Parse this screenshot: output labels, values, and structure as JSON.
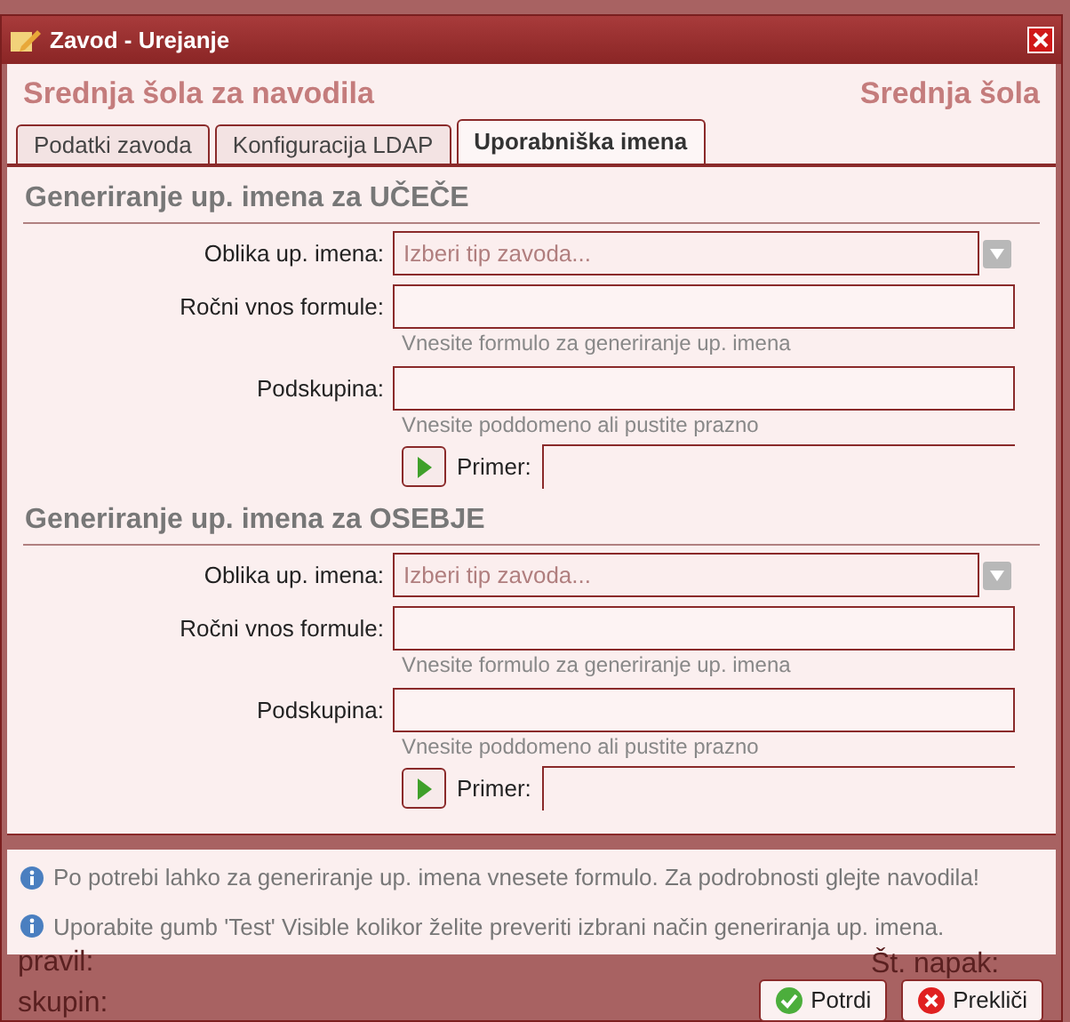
{
  "background_texts": [
    "pravil:",
    "skupin:",
    "Št. napak:"
  ],
  "window": {
    "title": "Zavod - Urejanje"
  },
  "header": {
    "name": "Srednja šola za navodila",
    "short_name": "Srednja šola"
  },
  "tabs": [
    {
      "label": "Podatki zavoda",
      "selected": false
    },
    {
      "label": "Konfiguracija LDAP",
      "selected": false
    },
    {
      "label": "Uporabniška imena",
      "selected": true
    }
  ],
  "sections": [
    {
      "title": "Generiranje up. imena za UČEČE",
      "fields": [
        {
          "kind": "select",
          "label": "Oblika up. imena:",
          "placeholder": "Izberi tip zavoda..."
        },
        {
          "kind": "text",
          "label": "Ročni vnos formule:",
          "hint": "Vnesite formulo za generiranje up. imena"
        },
        {
          "kind": "text",
          "label": "Podskupina:",
          "hint": "Vnesite poddomeno ali pustite prazno"
        },
        {
          "kind": "test",
          "label": "Primer:"
        }
      ]
    },
    {
      "title": "Generiranje up. imena za OSEBJE",
      "fields": [
        {
          "kind": "select",
          "label": "Oblika up. imena:",
          "placeholder": "Izberi tip zavoda..."
        },
        {
          "kind": "text",
          "label": "Ročni vnos formule:",
          "hint": "Vnesite formulo za generiranje up. imena"
        },
        {
          "kind": "text",
          "label": "Podskupina:",
          "hint": "Vnesite poddomeno ali pustite prazno"
        },
        {
          "kind": "test",
          "label": "Primer:"
        }
      ]
    }
  ],
  "info": [
    "Po potrebi lahko za generiranje up. imena vnesete formulo. Za podrobnosti glejte navodila!",
    "Uporabite gumb 'Test' Visible kolikor želite preveriti izbrani način generiranja up. imena."
  ],
  "buttons": [
    {
      "label": "Potrdi",
      "kind": "ok"
    },
    {
      "label": "Prekliči",
      "kind": "cancel"
    }
  ]
}
